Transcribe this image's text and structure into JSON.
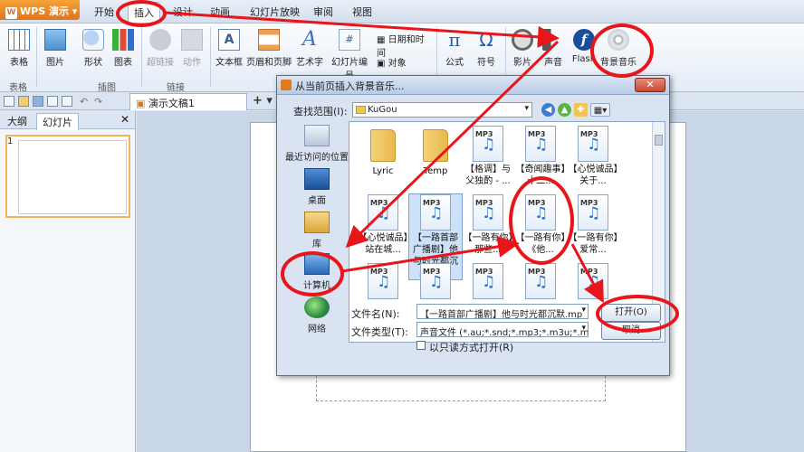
{
  "app": {
    "name": "WPS 演示",
    "logo": "W"
  },
  "menu": [
    "开始",
    "插入",
    "设计",
    "动画",
    "幻灯片放映",
    "审阅",
    "视图"
  ],
  "ribbon": {
    "table": "表格",
    "picture": "图片",
    "shape": "形状",
    "chart": "图表",
    "hyperlink": "超链接",
    "action": "动作",
    "textbox": "文本框",
    "header_footer": "页眉和页脚",
    "wordart": "艺术字",
    "slide_number": "幻灯片编号",
    "datetime": "日期和时间",
    "object": "对象",
    "formula": "公式",
    "symbol": "符号",
    "movie": "影片",
    "sound": "声音",
    "flash": "Flash",
    "bg_music": "背景音乐",
    "groups": {
      "table": "表格",
      "illustration": "插图",
      "link": "链接"
    }
  },
  "doc_tab": "演示文稿1",
  "panel": {
    "tab_outline": "大纲",
    "tab_slides": "幻灯片",
    "slide_no": "1"
  },
  "dialog": {
    "title": "从当前页插入背景音乐...",
    "look_in_label": "查找范围(I):",
    "look_in_value": "KuGou",
    "places": [
      "最近访问的位置",
      "桌面",
      "库",
      "计算机",
      "网络"
    ],
    "files": [
      {
        "type": "folder",
        "name": "Lyric"
      },
      {
        "type": "folder",
        "name": "Temp"
      },
      {
        "type": "mp3",
        "name": "【格调】与父独酌 - ..."
      },
      {
        "type": "mp3",
        "name": "【奇闻趣事】十二..."
      },
      {
        "type": "mp3",
        "name": "【心悦诚品】关于..."
      },
      {
        "type": "mp3",
        "name": "【心悦诚品】站在城..."
      },
      {
        "type": "mp3",
        "name": "【一路首部广播剧】他与时光都沉默.mp3"
      },
      {
        "type": "mp3",
        "name": "【一路有你】那些..."
      },
      {
        "type": "mp3",
        "name": "【一路有你】《他..."
      },
      {
        "type": "mp3",
        "name": "【一路有你】爱常..."
      },
      {
        "type": "mp3",
        "name": ""
      },
      {
        "type": "mp3",
        "name": ""
      },
      {
        "type": "mp3",
        "name": ""
      },
      {
        "type": "mp3",
        "name": ""
      },
      {
        "type": "mp3",
        "name": ""
      }
    ],
    "mp3_tag": "MP3",
    "filename_label": "文件名(N):",
    "filename_value": "【一路首部广播剧】他与时光都沉默.mp",
    "filetype_label": "文件类型(T):",
    "filetype_value": "声音文件 (*.au;*.snd;*.mp3;*.m3u;*.mi",
    "readonly_label": "以只读方式打开(R)",
    "open_button": "打开(O)",
    "cancel_button": "取消"
  },
  "colors": {
    "accent": "#e8151b",
    "brand": "#e0761a"
  }
}
